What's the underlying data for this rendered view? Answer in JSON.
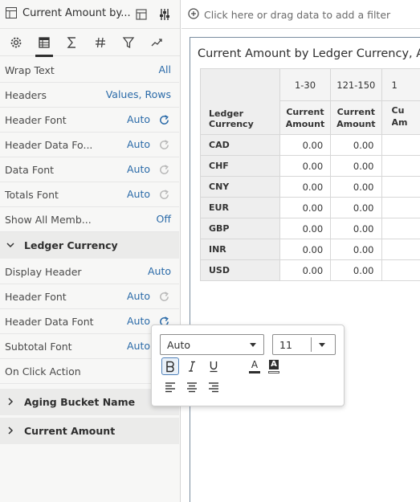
{
  "panel": {
    "title": "Current Amount by...",
    "properties": [
      {
        "label": "Wrap Text",
        "value": "All",
        "reset": "none"
      },
      {
        "label": "Headers",
        "value": "Values, Rows",
        "reset": "none"
      },
      {
        "label": "Header Font",
        "value": "Auto",
        "reset": "active"
      },
      {
        "label": "Header Data Fo...",
        "value": "Auto",
        "reset": "inactive"
      },
      {
        "label": "Data Font",
        "value": "Auto",
        "reset": "inactive"
      },
      {
        "label": "Totals Font",
        "value": "Auto",
        "reset": "inactive"
      },
      {
        "label": "Show All Memb...",
        "value": "Off",
        "reset": "none"
      }
    ],
    "sections": [
      {
        "name": "Ledger Currency",
        "expanded": true,
        "properties": [
          {
            "label": "Display Header",
            "value": "Auto",
            "reset": "none"
          },
          {
            "label": "Header Font",
            "value": "Auto",
            "reset": "inactive"
          },
          {
            "label": "Header Data Font",
            "value": "Auto",
            "reset": "active"
          },
          {
            "label": "Subtotal Font",
            "value": "Auto",
            "reset": "inactive"
          },
          {
            "label": "On Click Action",
            "value": "",
            "reset": "none"
          }
        ]
      },
      {
        "name": "Aging Bucket Name",
        "expanded": false
      },
      {
        "name": "Current Amount",
        "expanded": false
      }
    ]
  },
  "filter_bar": {
    "hint": "Click here or drag data to add a filter"
  },
  "viz": {
    "title": "Current Amount by Ledger Currency, Aging",
    "row_header": "Ledger Currency",
    "buckets": [
      "1-30",
      "121-150",
      "1"
    ],
    "measure": "Current Amount",
    "measure_clipped": "Cu Am",
    "rows": [
      {
        "currency": "CAD",
        "values": [
          "0.00",
          "0.00"
        ]
      },
      {
        "currency": "CHF",
        "values": [
          "0.00",
          "0.00"
        ]
      },
      {
        "currency": "CNY",
        "values": [
          "0.00",
          "0.00"
        ]
      },
      {
        "currency": "EUR",
        "values": [
          "0.00",
          "0.00"
        ]
      },
      {
        "currency": "GBP",
        "values": [
          "0.00",
          "0.00"
        ]
      },
      {
        "currency": "INR",
        "values": [
          "0.00",
          "0.00"
        ]
      },
      {
        "currency": "USD",
        "values": [
          "0.00",
          "0.00"
        ]
      }
    ]
  },
  "font_popup": {
    "font_family": "Auto",
    "font_size": "11",
    "bold": true,
    "italic": false,
    "underline": false,
    "text_color_label": "A",
    "background_color_label": "A"
  },
  "colors": {
    "link": "#2a6aa8",
    "accent": "#4f80b8",
    "panel_bg": "#f7f7f6"
  },
  "icons": {
    "title": "table-icon",
    "tabs": [
      "gear-icon",
      "table-tab-icon",
      "sigma-icon",
      "number-format-icon",
      "filter-icon",
      "analytics-icon"
    ],
    "reset": "reset-icon",
    "add_filter": "add-circle-icon"
  }
}
